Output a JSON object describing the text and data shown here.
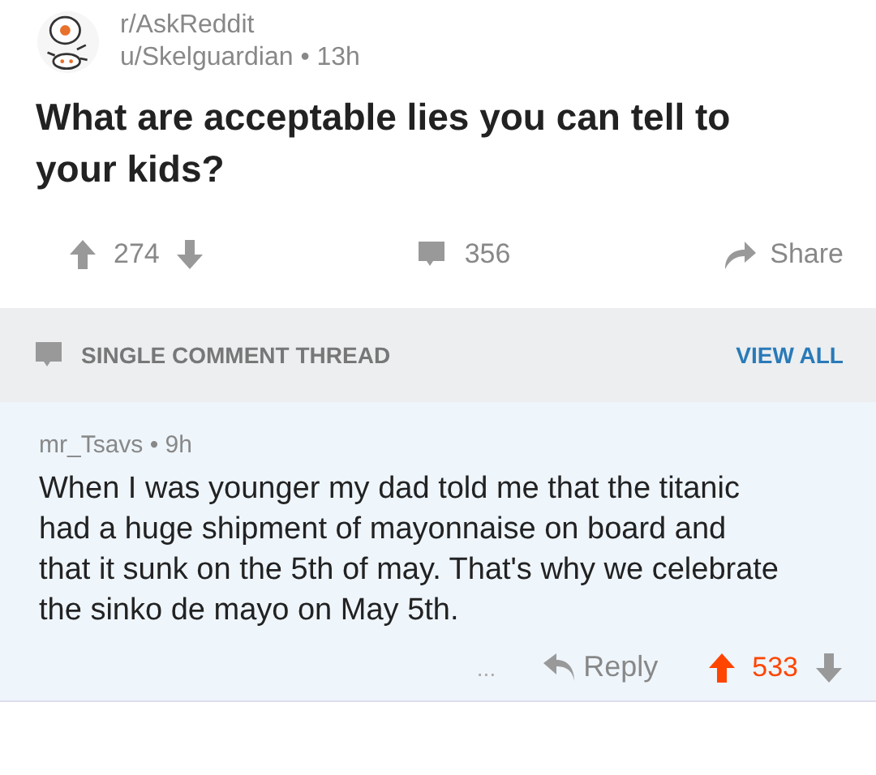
{
  "post": {
    "subreddit": "r/AskReddit",
    "byline": "u/Skelguardian • 13h",
    "title": "What are acceptable lies you can tell to your kids?",
    "score": "274",
    "upvoted": false,
    "comments": "356",
    "share": "Share"
  },
  "thread_bar": {
    "label": "SINGLE COMMENT THREAD",
    "link": "VIEW ALL"
  },
  "comment": {
    "byline": "mr_Tsavs • 9h",
    "text": "When I was younger my dad told me that the titanic had a huge shipment of mayonnaise on board and that it sunk on the 5th of may. That's why we celebrate the sinko de mayo on May 5th.",
    "more": "...",
    "reply": "Reply",
    "score": "533",
    "upvoted": true
  }
}
